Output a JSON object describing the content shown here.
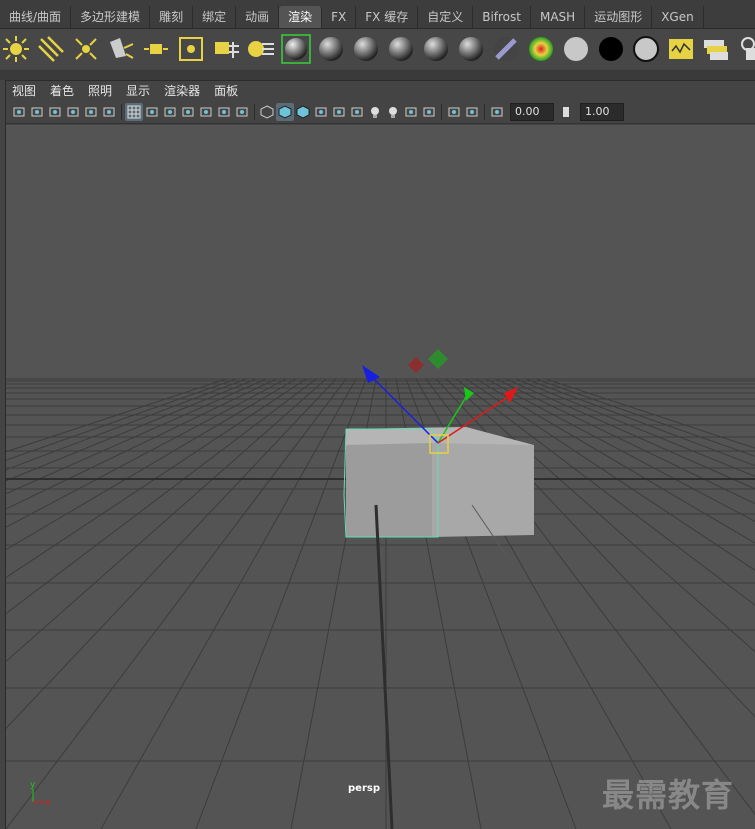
{
  "tabs": [
    {
      "label": "曲线/曲面"
    },
    {
      "label": "多边形建模"
    },
    {
      "label": "雕刻"
    },
    {
      "label": "绑定"
    },
    {
      "label": "动画"
    },
    {
      "label": "渲染",
      "active": true
    },
    {
      "label": "FX"
    },
    {
      "label": "FX 缓存"
    },
    {
      "label": "自定义"
    },
    {
      "label": "Bifrost"
    },
    {
      "label": "MASH"
    },
    {
      "label": "运动图形"
    },
    {
      "label": "XGen"
    }
  ],
  "shelf_icons": [
    "ambient-light",
    "directional-light",
    "point-light",
    "spot-light",
    "area-light",
    "volume-light",
    "render-layer",
    "render-settings",
    "material-ball-selected",
    "material-ball-2",
    "material-ball-3",
    "material-ball-4",
    "material-ball-5",
    "material-ball-6",
    "stripe-material",
    "ramp-material",
    "white-swatch",
    "black-swatch",
    "grey-swatch",
    "render-view",
    "batch-render",
    "ipr-render"
  ],
  "panel_menu": [
    "视图",
    "着色",
    "照明",
    "显示",
    "渲染器",
    "面板"
  ],
  "panel_fields": {
    "exposure": "0.00",
    "gamma": "1.00"
  },
  "camera_label": "persp",
  "watermark": "最需教育",
  "axis_labels": {
    "y": "y",
    "x": "x"
  },
  "colors": {
    "accent": "#e6d243",
    "selection": "#5fe0b0",
    "x_axis": "#e01818",
    "y_axis": "#18c818",
    "z_axis": "#1820e0"
  }
}
